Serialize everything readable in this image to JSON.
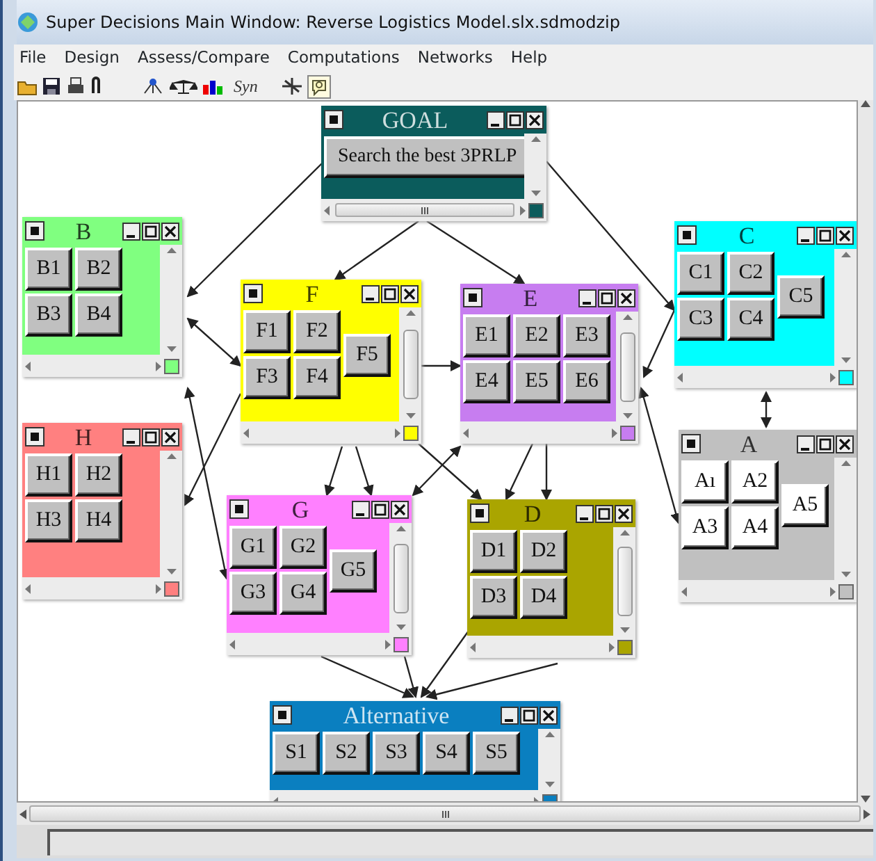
{
  "window": {
    "title": "Super Decisions Main Window: Reverse Logistics Model.slx.sdmodzip"
  },
  "menu": [
    "File",
    "Design",
    "Assess/Compare",
    "Computations",
    "Networks",
    "Help"
  ],
  "toolbar": {
    "syn_label": "Syn",
    "help_active": true
  },
  "clusters": [
    {
      "name": "GOAL",
      "color": "#0b5c5c",
      "kind": "wide",
      "highlighted": false,
      "scroll_thumb": false,
      "hscroll_thumb": true,
      "nodes": [
        "Search the best 3PRLP"
      ]
    },
    {
      "name": "B",
      "color": "#80ff80",
      "kind": "grid2",
      "highlighted": false,
      "scroll_thumb": false,
      "hscroll_thumb": false,
      "nodes": [
        "B1",
        "B2",
        "B3",
        "B4"
      ]
    },
    {
      "name": "F",
      "color": "#ffff00",
      "kind": "grid2plus",
      "highlighted": false,
      "scroll_thumb": true,
      "hscroll_thumb": false,
      "nodes": [
        "F1",
        "F2",
        "F3",
        "F4",
        "F5"
      ]
    },
    {
      "name": "E",
      "color": "#c77df0",
      "kind": "grid3",
      "highlighted": false,
      "scroll_thumb": true,
      "hscroll_thumb": false,
      "nodes": [
        "E1",
        "E2",
        "E3",
        "E4",
        "E5",
        "E6"
      ]
    },
    {
      "name": "C",
      "color": "#00ffff",
      "kind": "grid2plus",
      "highlighted": false,
      "scroll_thumb": false,
      "hscroll_thumb": false,
      "nodes": [
        "C1",
        "C2",
        "C3",
        "C4",
        "C5"
      ]
    },
    {
      "name": "H",
      "color": "#ff8080",
      "kind": "grid2",
      "highlighted": false,
      "scroll_thumb": false,
      "hscroll_thumb": false,
      "nodes": [
        "H1",
        "H2",
        "H3",
        "H4"
      ]
    },
    {
      "name": "A",
      "color": "#c0c0c0",
      "kind": "grid2plus",
      "highlighted": true,
      "scroll_thumb": false,
      "hscroll_thumb": false,
      "nodes": [
        "Aı",
        "A2",
        "A3",
        "A4",
        "A5"
      ]
    },
    {
      "name": "G",
      "color": "#ff80ff",
      "kind": "grid2plus",
      "highlighted": false,
      "scroll_thumb": true,
      "hscroll_thumb": false,
      "nodes": [
        "G1",
        "G2",
        "G3",
        "G4",
        "G5"
      ]
    },
    {
      "name": "D",
      "color": "#aaa500",
      "kind": "grid2",
      "highlighted": false,
      "scroll_thumb": true,
      "hscroll_thumb": false,
      "nodes": [
        "D1",
        "D2",
        "D3",
        "D4"
      ]
    },
    {
      "name": "Alternative",
      "color": "#0a7fc0",
      "kind": "row",
      "highlighted": false,
      "scroll_thumb": false,
      "hscroll_thumb": false,
      "nodes": [
        "S1",
        "S2",
        "S3",
        "S4",
        "S5"
      ]
    }
  ]
}
